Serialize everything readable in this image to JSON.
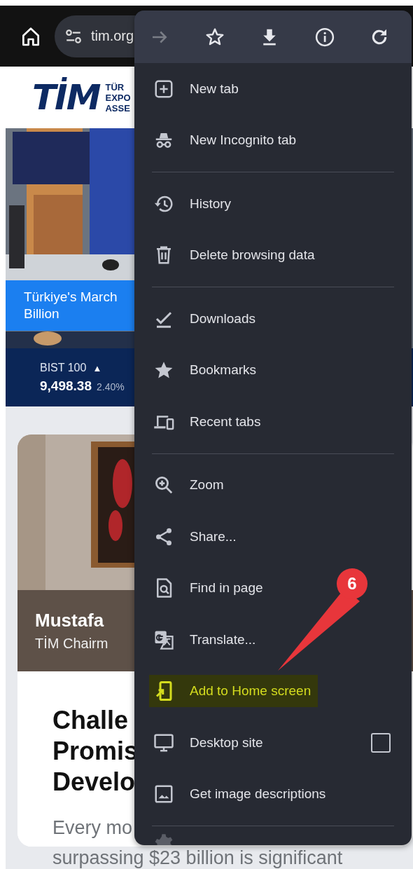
{
  "browser": {
    "url": "tim.org"
  },
  "page": {
    "logo": {
      "mark": "TİM",
      "lines": [
        "TÜR",
        "EXPO",
        "ASSE"
      ]
    },
    "hero": {
      "caption": [
        "Türkiye's March",
        "Billion"
      ]
    },
    "ticker": {
      "label": "BIST 100",
      "arrow": "▲",
      "value": "9,498.38",
      "change": "2.40%"
    },
    "card": {
      "name": "Mustafa",
      "role": "TİM Chairm"
    },
    "article": {
      "heading": [
        "Challe",
        "Promis",
        "Develo"
      ],
      "lead": "Every mo",
      "line": "surpassing $23 billion is significant"
    }
  },
  "menu": {
    "toolbar": [
      {
        "kind": "forward",
        "disabled": true
      },
      {
        "kind": "star",
        "disabled": false
      },
      {
        "kind": "download",
        "disabled": false
      },
      {
        "kind": "info",
        "disabled": false
      },
      {
        "kind": "refresh",
        "disabled": false
      }
    ],
    "sections": [
      [
        {
          "kind": "item",
          "label": "New tab",
          "highlighted": false
        },
        {
          "kind": "item",
          "label": "New Incognito tab",
          "highlighted": false
        }
      ],
      [
        {
          "kind": "item",
          "label": "History",
          "highlighted": false
        },
        {
          "kind": "item",
          "label": "Delete browsing data",
          "highlighted": false
        }
      ],
      [
        {
          "kind": "item",
          "label": "Downloads",
          "highlighted": false
        },
        {
          "kind": "item",
          "label": "Bookmarks",
          "highlighted": false
        },
        {
          "kind": "item",
          "label": "Recent tabs",
          "highlighted": false
        }
      ],
      [
        {
          "kind": "item",
          "label": "Zoom",
          "highlighted": false
        },
        {
          "kind": "item",
          "label": "Share...",
          "highlighted": false
        },
        {
          "kind": "item",
          "label": "Find in page",
          "highlighted": false
        },
        {
          "kind": "item",
          "label": "Translate...",
          "highlighted": false
        },
        {
          "kind": "item",
          "label": "Add to Home screen",
          "highlighted": true
        },
        {
          "kind": "checkbox",
          "label": "Desktop site",
          "highlighted": false,
          "checked": false
        },
        {
          "kind": "item",
          "label": "Get image descriptions",
          "highlighted": false
        }
      ],
      [
        {
          "kind": "settings"
        }
      ]
    ]
  },
  "annotation": {
    "number": "6"
  }
}
